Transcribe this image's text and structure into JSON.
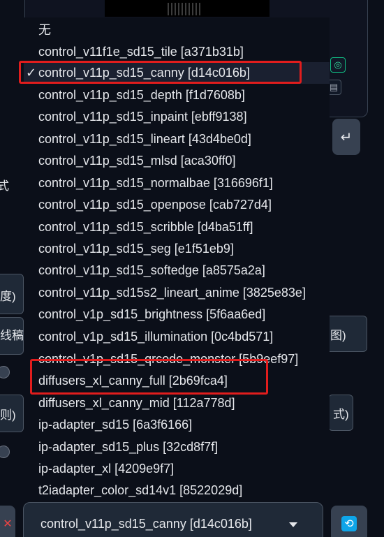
{
  "dropdown": {
    "items": [
      {
        "label": "无"
      },
      {
        "label": "control_v11f1e_sd15_tile [a371b31b]"
      },
      {
        "label": "control_v11p_sd15_canny [d14c016b]",
        "checked": true,
        "check_mark": "✓"
      },
      {
        "label": "control_v11p_sd15_depth [f1d7608b]"
      },
      {
        "label": "control_v11p_sd15_inpaint [ebff9138]"
      },
      {
        "label": "control_v11p_sd15_lineart [43d4be0d]"
      },
      {
        "label": "control_v11p_sd15_mlsd [aca30ff0]"
      },
      {
        "label": "control_v11p_sd15_normalbae [316696f1]"
      },
      {
        "label": "control_v11p_sd15_openpose [cab727d4]"
      },
      {
        "label": "control_v11p_sd15_scribble [d4ba51ff]"
      },
      {
        "label": "control_v11p_sd15_seg [e1f51eb9]"
      },
      {
        "label": "control_v11p_sd15_softedge [a8575a2a]"
      },
      {
        "label": "control_v11p_sd15s2_lineart_anime [3825e83e]"
      },
      {
        "label": "control_v1p_sd15_brightness [5f6aa6ed]"
      },
      {
        "label": "control_v1p_sd15_illumination [0c4bd571]"
      },
      {
        "label": "control_v1p_sd15_qrcode_monster [5b9eef97]"
      },
      {
        "label": "diffusers_xl_canny_full [2b69fca4]"
      },
      {
        "label": "diffusers_xl_canny_mid [112a778d]"
      },
      {
        "label": "ip-adapter_sd15 [6a3f6166]"
      },
      {
        "label": "ip-adapter_sd15_plus [32cd8f7f]"
      },
      {
        "label": "ip-adapter_xl [4209e9f7]"
      },
      {
        "label": "t2iadapter_color_sd14v1 [8522029d]"
      }
    ]
  },
  "model_select": {
    "value": "control_v11p_sd15_canny [d14c016b]"
  },
  "background": {
    "edge_left_texts": [
      "式",
      "度)",
      "线稿",
      "则)"
    ],
    "edge_right_texts": [
      "图)",
      "式)"
    ],
    "send_icon": "↵",
    "left_edge_icon": "✕",
    "refresh_icon": "⟲"
  },
  "colors": {
    "highlight": "#e11d1d",
    "background": "#0b0f19",
    "accent_icon": "#0ea5e9"
  }
}
